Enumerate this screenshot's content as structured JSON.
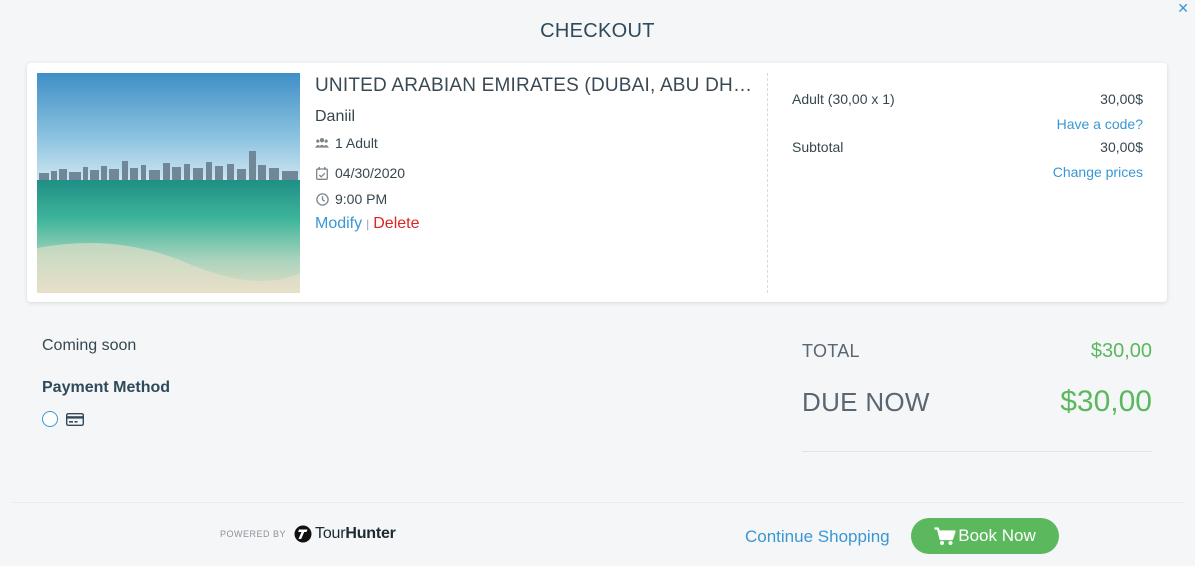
{
  "page": {
    "title": "CHECKOUT"
  },
  "booking": {
    "tour_title": "UNITED ARABIAN EMIRATES (DUBAI, ABU DHABI...",
    "customer": "Daniil",
    "participants": "1 Adult",
    "date": "04/30/2020",
    "time": "9:00 PM",
    "modify_label": "Modify",
    "separator": "|",
    "delete_label": "Delete",
    "image_icon": "city-skyline-beach-photo"
  },
  "pricing": {
    "line_label": "Adult (30,00 x 1)",
    "line_amount": "30,00$",
    "promo_link": "Have a code?",
    "subtotal_label": "Subtotal",
    "subtotal_amount": "30,00$",
    "change_prices_link": "Change prices"
  },
  "payment": {
    "coming_soon": "Coming soon",
    "method_label": "Payment Method",
    "method_icon": "credit-card-icon"
  },
  "totals": {
    "total_label": "TOTAL",
    "total_value": "$30,00",
    "due_label": "DUE NOW",
    "due_value": "$30,00"
  },
  "footer": {
    "powered_by": "POWERED BY",
    "brand_part1": "Tour",
    "brand_part2": "Hunter",
    "continue_label": "Continue Shopping",
    "book_label": "Book Now"
  },
  "colors": {
    "accent": "#3a97d4",
    "success": "#5cb85c",
    "danger": "#e02424",
    "text": "#37474f"
  }
}
